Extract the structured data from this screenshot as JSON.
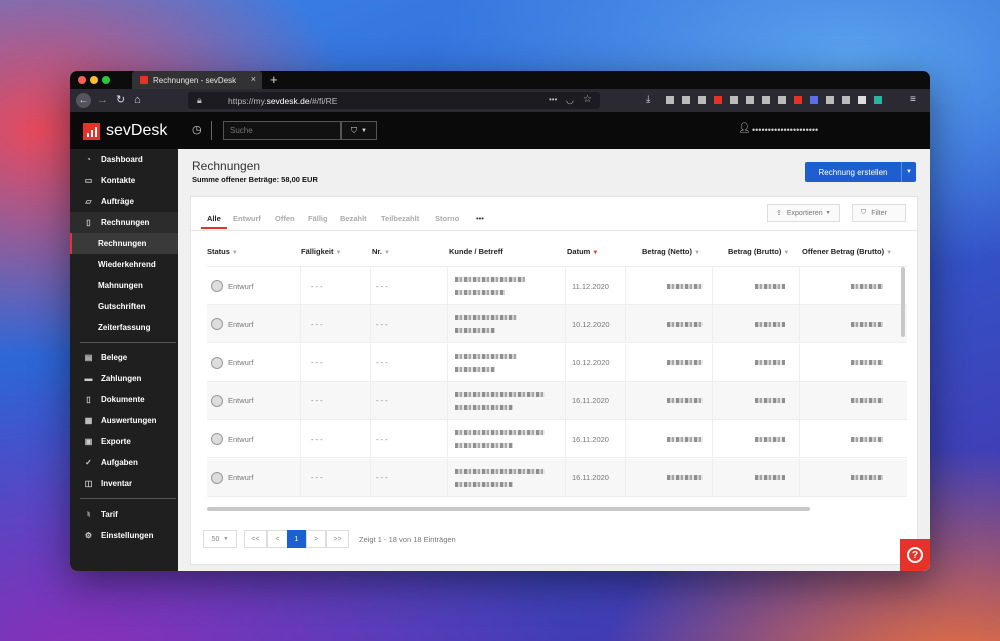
{
  "browser": {
    "tab_title": "Rechnungen - sevDesk",
    "tab_close": "×",
    "new_tab": "+",
    "url_prefix": "https://my.",
    "url_domain": "sevdesk.de",
    "url_path": "/#/fi/RE",
    "page_actions": "•••"
  },
  "app": {
    "logo_text": "sevDesk",
    "search_placeholder": "Suche",
    "user_name": "•••••••••••••••••••••"
  },
  "sidebar": {
    "items": [
      {
        "label": "Dashboard",
        "icon": "dashboard-icon"
      },
      {
        "label": "Kontakte",
        "icon": "contacts-icon"
      },
      {
        "label": "Aufträge",
        "icon": "orders-icon"
      },
      {
        "label": "Rechnungen",
        "icon": "invoice-icon"
      }
    ],
    "subitems": [
      "Rechnungen",
      "Wiederkehrend",
      "Mahnungen",
      "Gutschriften",
      "Zeiterfassung"
    ],
    "items2": [
      {
        "label": "Belege",
        "icon": "receipt-icon"
      },
      {
        "label": "Zahlungen",
        "icon": "payment-icon"
      },
      {
        "label": "Dokumente",
        "icon": "documents-icon"
      },
      {
        "label": "Auswertungen",
        "icon": "reports-icon"
      },
      {
        "label": "Exporte",
        "icon": "export-icon"
      },
      {
        "label": "Aufgaben",
        "icon": "tasks-icon"
      },
      {
        "label": "Inventar",
        "icon": "inventory-icon"
      }
    ],
    "items3": [
      {
        "label": "Tarif",
        "icon": "bell-icon"
      },
      {
        "label": "Einstellungen",
        "icon": "gear-icon"
      }
    ]
  },
  "page": {
    "title": "Rechnungen",
    "subtitle": "Summe offener Beträge: 58,00 EUR",
    "create_button": "Rechnung erstellen"
  },
  "filter_tabs": [
    "Alle",
    "Entwurf",
    "Offen",
    "Fällig",
    "Bezahlt",
    "Teilbezahlt",
    "Storno",
    "•••"
  ],
  "toolbar": {
    "export_label": "Exportieren",
    "filter_label": "Filter"
  },
  "table": {
    "columns": [
      "Status",
      "Fälligkeit",
      "Nr.",
      "Kunde / Betreff",
      "Datum",
      "Betrag (Netto)",
      "Betrag (Brutto)",
      "Offener Betrag (Brutto)"
    ],
    "rows": [
      {
        "status": "Entwurf",
        "due": "- - -",
        "nr": "- - -",
        "date": "11.12.2020"
      },
      {
        "status": "Entwurf",
        "due": "- - -",
        "nr": "- - -",
        "date": "10.12.2020"
      },
      {
        "status": "Entwurf",
        "due": "- - -",
        "nr": "- - -",
        "date": "10.12.2020"
      },
      {
        "status": "Entwurf",
        "due": "- - -",
        "nr": "- - -",
        "date": "16.11.2020"
      },
      {
        "status": "Entwurf",
        "due": "- - -",
        "nr": "- - -",
        "date": "16.11.2020"
      },
      {
        "status": "Entwurf",
        "due": "- - -",
        "nr": "- - -",
        "date": "16.11.2020"
      }
    ]
  },
  "pagination": {
    "page_size": "50",
    "first": "<<",
    "prev": "<",
    "current": "1",
    "next": ">",
    "last": ">>",
    "info": "Zeigt 1 - 18 von 18 Einträgen"
  },
  "help": {
    "label": "?"
  }
}
